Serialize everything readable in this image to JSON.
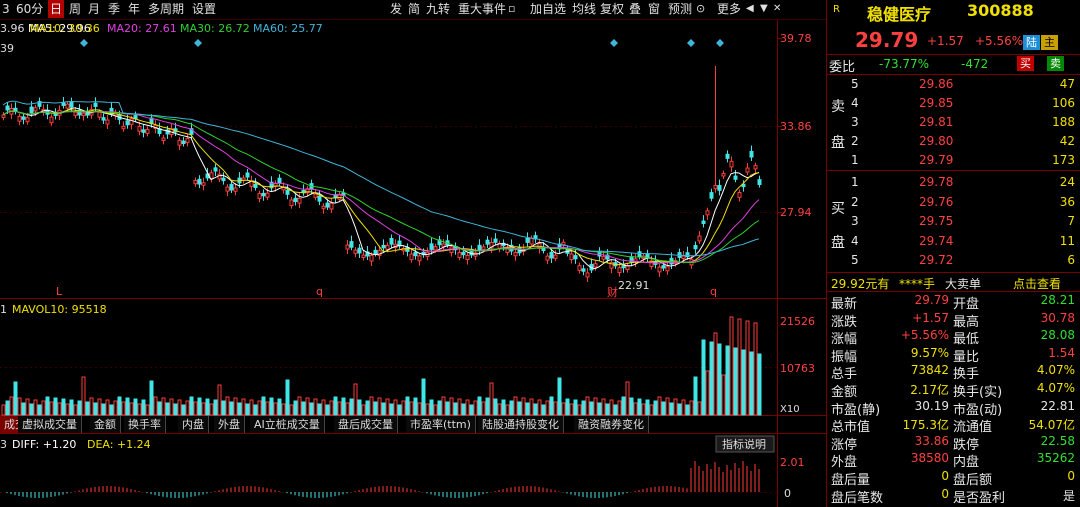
{
  "toolbar": {
    "left_tabs": [
      "3",
      "60分",
      "日",
      "周",
      "月",
      "季",
      "年",
      "多周期",
      "设置"
    ],
    "active_tab": "日",
    "right_buttons": [
      "发",
      "简",
      "九转",
      "重大事件",
      "",
      "加自选",
      "均线",
      "复权",
      "叠",
      "窗",
      "预测",
      "",
      "更多",
      ""
    ],
    "close_icons": [
      "◀",
      "▼",
      "✕"
    ]
  },
  "ma_legend": {
    "prefix": "3.96",
    "ma5": "MA5: 29.96",
    "ma10": "MA10: 30.36",
    "ma20": "MA20: 27.61",
    "ma30": "MA30: 26.72",
    "ma60": "MA60: 25.77",
    "second_line": "39"
  },
  "price_axis": {
    "high": "39.78",
    "mid": "33.86",
    "low": "27.94"
  },
  "markers": {
    "L": "L",
    "q1": "q",
    "q2": "q",
    "min_price": "22.91",
    "cai": "财"
  },
  "vol_legend": {
    "prefix": "1",
    "mavol10": "MAVOL10: 95518"
  },
  "vol_axis": {
    "top": "21526",
    "mid": "10763",
    "unit": "X10"
  },
  "bottom_tabs": [
    "成交量",
    "虚拟成交量",
    "金额",
    "换手率",
    "内盘",
    "外盘",
    "AI立桩成交量",
    "盘后成交量",
    "市盈率(ttm)",
    "陆股通持股变化",
    "融资融券变化"
  ],
  "macd_legend": {
    "prefix": "3",
    "diff": "DIFF: +1.20",
    "dea": "DEA: +1.24"
  },
  "macd_axis": {
    "top": "2.01",
    "zero": "0"
  },
  "indicator_btn": "指标说明",
  "stock": {
    "r": "R",
    "name": "稳健医疗",
    "code": "300888",
    "price": "29.79",
    "change": "+1.57",
    "pct": "+5.56%",
    "tag_lu": "陆",
    "tag_zhu": "主",
    "weibi_label": "委比",
    "weibi": "-73.77%",
    "weicha": "-472",
    "buy_btn": "买",
    "sell_btn": "卖"
  },
  "sell_side_label": [
    "卖",
    "盘"
  ],
  "buy_side_label": [
    "买",
    "盘"
  ],
  "asks": [
    {
      "level": "5",
      "price": "29.86",
      "vol": "47"
    },
    {
      "level": "4",
      "price": "29.85",
      "vol": "106"
    },
    {
      "level": "3",
      "price": "29.81",
      "vol": "188"
    },
    {
      "level": "2",
      "price": "29.80",
      "vol": "42"
    },
    {
      "level": "1",
      "price": "29.79",
      "vol": "173"
    }
  ],
  "bids": [
    {
      "level": "1",
      "price": "29.78",
      "vol": "24"
    },
    {
      "level": "2",
      "price": "29.76",
      "vol": "36"
    },
    {
      "level": "3",
      "price": "29.75",
      "vol": "7"
    },
    {
      "level": "4",
      "price": "29.74",
      "vol": "11"
    },
    {
      "level": "5",
      "price": "29.72",
      "vol": "6"
    }
  ],
  "big_order": {
    "price": "29.92元有",
    "hand": "****手",
    "label": "大卖单",
    "link": "点击查看"
  },
  "stats": [
    {
      "l1": "最新",
      "v1": "29.79",
      "c1": "red",
      "l2": "开盘",
      "v2": "28.21",
      "c2": "green"
    },
    {
      "l1": "涨跌",
      "v1": "+1.57",
      "c1": "red",
      "l2": "最高",
      "v2": "30.78",
      "c2": "red"
    },
    {
      "l1": "涨幅",
      "v1": "+5.56%",
      "c1": "red",
      "l2": "最低",
      "v2": "28.08",
      "c2": "green"
    },
    {
      "l1": "振幅",
      "v1": "9.57%",
      "c1": "yellow",
      "l2": "量比",
      "v2": "1.54",
      "c2": "red"
    },
    {
      "l1": "总手",
      "v1": "73842",
      "c1": "yellow",
      "l2": "换手",
      "v2": "4.07%",
      "c2": "yellow"
    },
    {
      "l1": "金额",
      "v1": "2.17亿",
      "c1": "yellow",
      "l2": "换手(实)",
      "v2": "4.07%",
      "c2": "yellow"
    },
    {
      "l1": "市盈(静)",
      "v1": "30.19",
      "c1": "white",
      "l2": "市盈(动)",
      "v2": "22.81",
      "c2": "white"
    },
    {
      "l1": "总市值",
      "v1": "175.3亿",
      "c1": "yellow",
      "l2": "流通值",
      "v2": "54.07亿",
      "c2": "yellow"
    },
    {
      "l1": "涨停",
      "v1": "33.86",
      "c1": "red",
      "l2": "跌停",
      "v2": "22.58",
      "c2": "green"
    },
    {
      "l1": "外盘",
      "v1": "38580",
      "c1": "red",
      "l2": "内盘",
      "v2": "35262",
      "c2": "green"
    },
    {
      "l1": "盘后量",
      "v1": "0",
      "c1": "yellow",
      "l2": "盘后额",
      "v2": "0",
      "c2": "yellow"
    },
    {
      "l1": "盘后笔数",
      "v1": "0",
      "c1": "yellow",
      "l2": "是否盈利",
      "v2": "是",
      "c2": "white"
    }
  ],
  "colors": {
    "up": "#ff3c3c",
    "down": "#3fe6e6",
    "ma5": "#ffffff",
    "ma10": "#f0e000",
    "ma20": "#e040e0",
    "ma30": "#30d030",
    "ma60": "#3fb5d8",
    "frame": "#7a0000"
  }
}
